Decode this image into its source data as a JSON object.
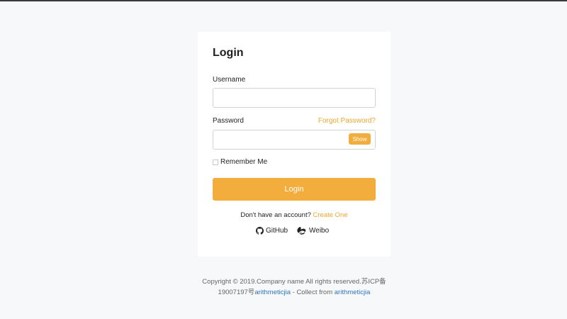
{
  "login": {
    "title": "Login",
    "username_label": "Username",
    "username_value": "",
    "password_label": "Password",
    "password_value": "",
    "forgot_label": "Forgot Password?",
    "show_label": "Show",
    "remember_label": "Remember Me",
    "submit_label": "Login",
    "signup_prompt": "Don't have an account?",
    "signup_link": "Create One",
    "social": {
      "github_label": "GitHub",
      "weibo_label": "Weibo"
    }
  },
  "footer": {
    "line1": "Copyright © 2019.Company name All rights reserved.苏ICP备",
    "line2_prefix": "19007197号",
    "author_link": "arithmeticjia",
    "collect_text": " - Collect from ",
    "collect_link": "arithmeticjia"
  },
  "colors": {
    "accent": "#f3ad3d",
    "link_blue": "#2f74c0",
    "background": "#f7f8fa",
    "card": "#ffffff"
  },
  "icons": [
    "github-icon",
    "weibo-icon"
  ]
}
